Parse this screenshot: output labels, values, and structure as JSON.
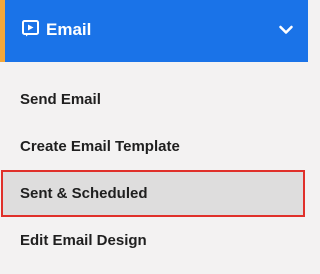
{
  "colors": {
    "header_background": "#1a73e8",
    "header_accent": "#f2a73b",
    "header_text": "#ffffff",
    "menu_background": "#f3f2f2",
    "selected_background": "#dedddd",
    "selected_border": "#e0302a",
    "item_text": "#1f1f1f"
  },
  "header": {
    "title": "Email",
    "icon": "email-play-icon",
    "toggle_icon": "chevron-down-icon",
    "expanded": true
  },
  "menu": {
    "items": [
      {
        "label": "Send Email",
        "selected": false
      },
      {
        "label": "Create Email Template",
        "selected": false
      },
      {
        "label": "Sent & Scheduled",
        "selected": true
      },
      {
        "label": "Edit Email Design",
        "selected": false
      }
    ]
  }
}
